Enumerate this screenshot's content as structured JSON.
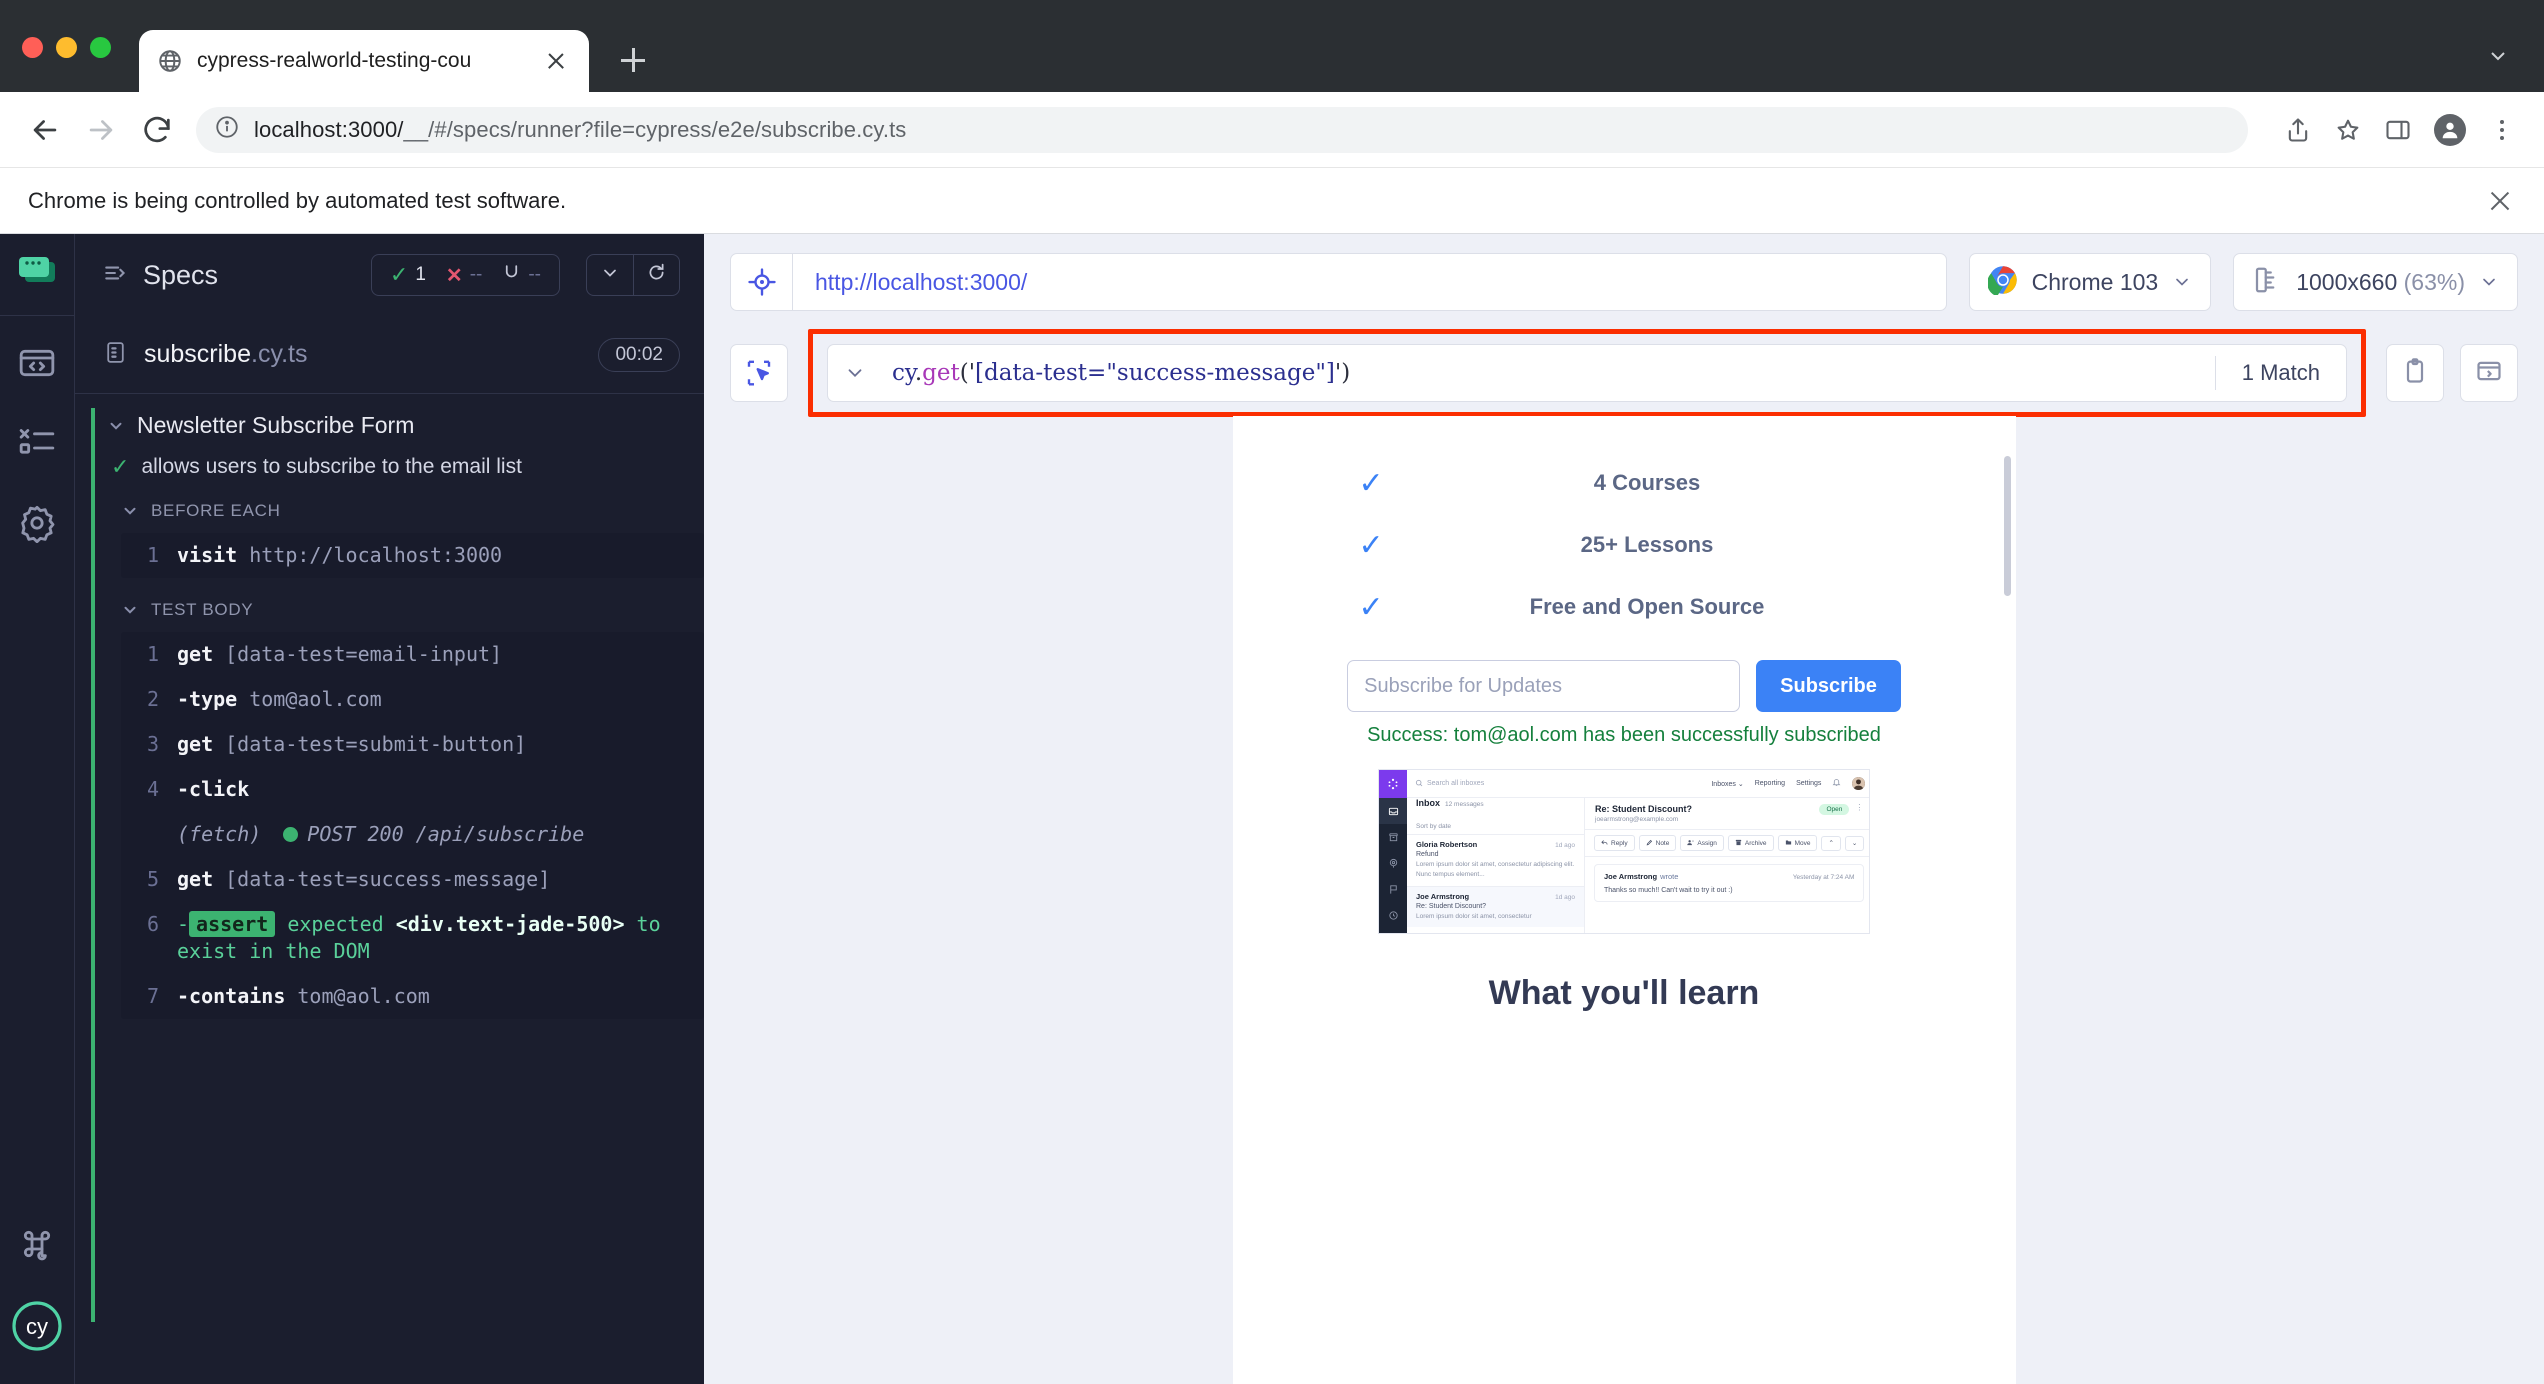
{
  "browser": {
    "tab": {
      "title": "cypress-realworld-testing-cou",
      "favicon_icon": "globe-icon",
      "close_icon": "close-icon"
    },
    "new_tab_icon": "plus-icon",
    "tabstrip_caret_icon": "chevron-down-icon",
    "back_icon": "arrow-left-icon",
    "forward_icon": "arrow-right-icon",
    "reload_icon": "reload-icon",
    "info_icon": "info-circle-icon",
    "url_host": "localhost:3000/",
    "url_path": "__/#/specs/runner?file=cypress/e2e/subscribe.cy.ts",
    "share_icon": "share-icon",
    "bookmark_icon": "star-icon",
    "sidepanel_icon": "side-panel-icon",
    "profile_icon": "profile-avatar-icon",
    "menu_icon": "kebab-menu-icon",
    "infobar_text": "Chrome is being controlled by automated test software.",
    "infobar_close_icon": "close-icon"
  },
  "rail": {
    "logo_icon": "cypress-app-icon",
    "items": [
      {
        "icon": "code-specs-icon",
        "name": "specs"
      },
      {
        "icon": "runs-list-icon",
        "name": "runs"
      },
      {
        "icon": "gear-icon",
        "name": "settings"
      }
    ],
    "shortcut_icon": "command-key-icon",
    "brand_icon": "cypress-cy-logo"
  },
  "specs": {
    "header_icon": "specs-list-icon",
    "title": "Specs",
    "stats": {
      "passed_icon": "check-icon",
      "passed": "1",
      "failed_icon": "x-icon",
      "failed": "--",
      "pending_icon": "pending-icon",
      "pending": "--"
    },
    "collapse_icon": "chevron-down-icon",
    "rerun_icon": "reload-icon",
    "file_icon": "file-icon",
    "file_name": "subscribe",
    "file_ext": ".cy.ts",
    "duration": "00:02",
    "suite": "Newsletter Subscribe Form",
    "test": "allows users to subscribe to the email list",
    "test_status_icon": "check-icon",
    "hooks": [
      {
        "label": "BEFORE EACH",
        "commands": [
          {
            "num": "1",
            "name": "visit",
            "arg": "http://localhost:3000",
            "kind": "normal"
          }
        ]
      },
      {
        "label": "TEST BODY",
        "commands": [
          {
            "num": "1",
            "name": "get",
            "arg": "[data-test=email-input]",
            "kind": "normal"
          },
          {
            "num": "2",
            "name": "-type",
            "arg": "tom@aol.com",
            "kind": "normal"
          },
          {
            "num": "3",
            "name": "get",
            "arg": "[data-test=submit-button]",
            "kind": "normal"
          },
          {
            "num": "4",
            "name": "-click",
            "arg": "",
            "kind": "normal"
          },
          {
            "num": "",
            "name": "(fetch)",
            "arg": "POST 200 /api/subscribe",
            "kind": "network"
          },
          {
            "num": "5",
            "name": "get",
            "arg": "[data-test=success-message]",
            "kind": "normal"
          },
          {
            "num": "6",
            "name": "-",
            "tag": "assert",
            "arg_pre": "expected",
            "element": "<div.text-jade-500>",
            "arg_post": "to exist in the DOM",
            "kind": "assert"
          },
          {
            "num": "7",
            "name": "-contains",
            "arg": "tom@aol.com",
            "kind": "normal"
          }
        ]
      }
    ]
  },
  "runner": {
    "target_icon": "crosshair-icon",
    "app_url": "http://localhost:3000/",
    "browser_icon": "chrome-icon",
    "browser_label": "Chrome 103",
    "viewport_icon": "ruler-icon",
    "viewport_label": "1000x660",
    "viewport_zoom": "(63%)",
    "dropdown_icon": "chevron-down-icon",
    "playground": {
      "toggle_icon": "selector-playground-icon",
      "caret_icon": "chevron-down-icon",
      "selector_obj": "cy",
      "selector_dot": ".",
      "selector_fn": "get",
      "selector_open": "('",
      "selector_value": "[data-test=\"success-message\"]",
      "selector_close": "')",
      "match_count": "1 Match",
      "copy_icon": "clipboard-icon",
      "print_icon": "print-to-console-icon",
      "highlight_color": "#fb2e01"
    }
  },
  "aut": {
    "features": [
      {
        "check_icon": "check-icon",
        "text": "4 Courses"
      },
      {
        "check_icon": "check-icon",
        "text": "25+ Lessons"
      },
      {
        "check_icon": "check-icon",
        "text": "Free and Open Source"
      }
    ],
    "subscribe_placeholder": "Subscribe for Updates",
    "subscribe_button": "Subscribe",
    "success_message": "Success: tom@aol.com has been successfully subscribed",
    "success_color": "#15803d",
    "learn_heading": "What you'll learn",
    "email_app": {
      "logo_icon": "app-logo-icon",
      "search_icon": "search-icon",
      "search_placeholder": "Search all inboxes",
      "nav": [
        "Inboxes",
        "Reporting",
        "Settings"
      ],
      "nav_caret_icon": "chevron-down-icon",
      "bell_icon": "bell-icon",
      "avatar_icon": "user-avatar",
      "rail_icons": [
        "inbox-icon",
        "archive-box-icon",
        "contacts-icon",
        "flag-icon",
        "clock-icon"
      ],
      "inbox_label": "Inbox",
      "inbox_count": "12 messages",
      "sort_label": "Sort by date",
      "messages": [
        {
          "from": "Gloria Robertson",
          "when": "1d ago",
          "subject": "Refund",
          "preview": "Lorem ipsum dolor sit amet, consectetur adipiscing elit. Nunc tempus element..."
        },
        {
          "from": "Joe Armstrong",
          "when": "1d ago",
          "subject": "Re: Student Discount?",
          "preview": "Lorem ipsum dolor sit amet, consectetur"
        }
      ],
      "thread_subject": "Re: Student Discount?",
      "thread_address": "joearmstrong@example.com",
      "thread_status": "Open",
      "thread_menu_icon": "kebab-menu-icon",
      "actions": [
        {
          "label": "Reply",
          "icon": "reply-icon"
        },
        {
          "label": "Note",
          "icon": "pencil-icon"
        },
        {
          "label": "Assign",
          "icon": "assign-user-icon"
        },
        {
          "label": "Archive",
          "icon": "archive-icon"
        },
        {
          "label": "Move",
          "icon": "move-folder-icon"
        }
      ],
      "prev_icon": "chevron-up-icon",
      "next_icon": "chevron-down-icon",
      "message_author": "Joe Armstrong",
      "message_verb": "wrote",
      "message_date": "Yesterday at 7:24 AM",
      "message_body": "Thanks so much!! Can't wait to try it out :)"
    }
  }
}
